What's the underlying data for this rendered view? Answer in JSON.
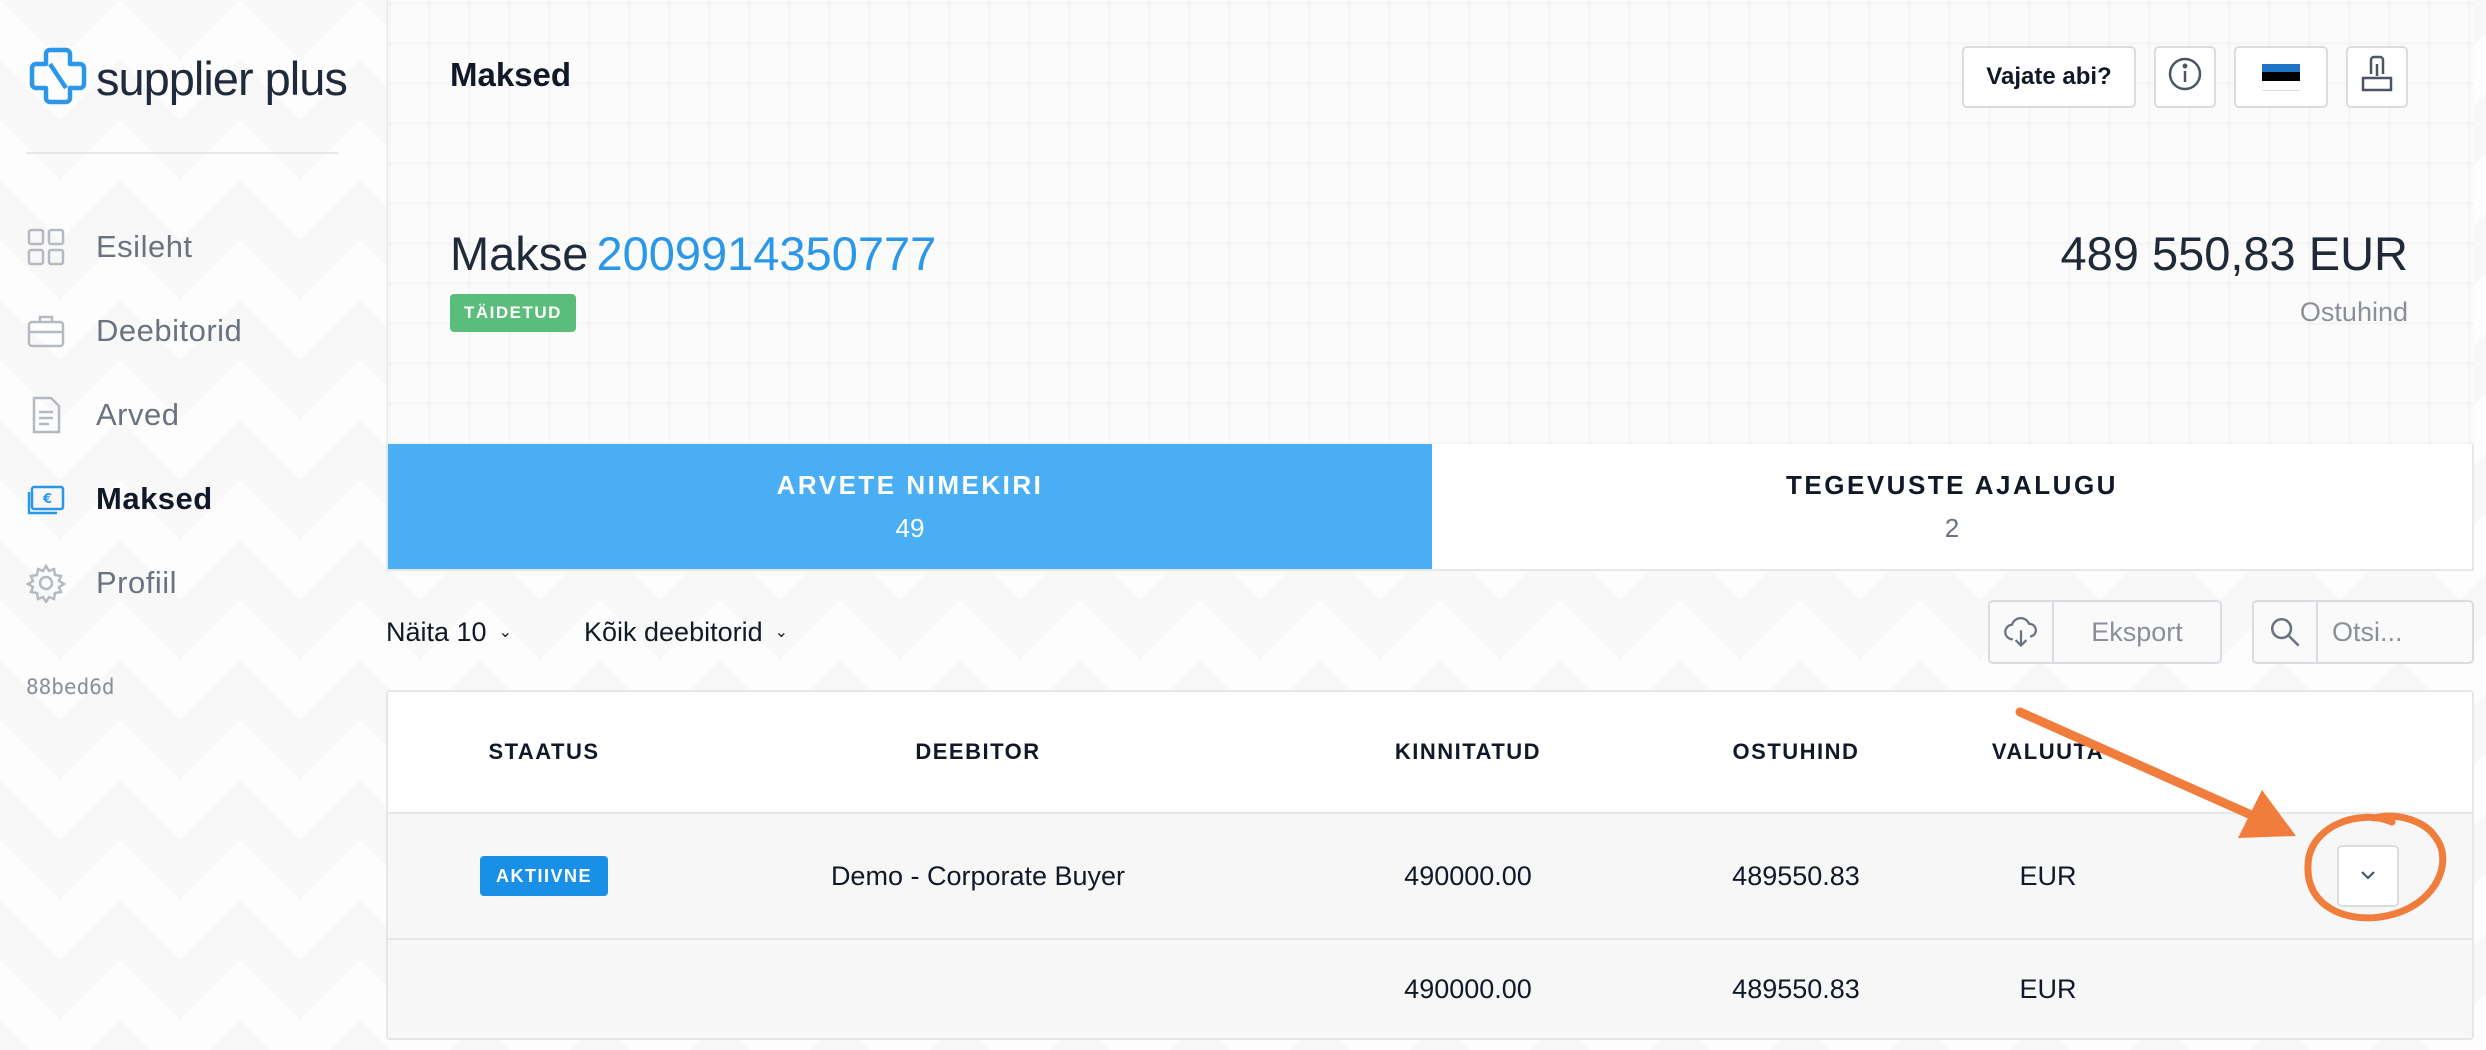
{
  "brand": {
    "name": "supplier plus",
    "color": "#2b97e8"
  },
  "sidebar": {
    "items": [
      {
        "label": "Esileht",
        "icon": "dashboard-grid-icon",
        "active": false
      },
      {
        "label": "Deebitorid",
        "icon": "briefcase-icon",
        "active": false
      },
      {
        "label": "Arved",
        "icon": "document-icon",
        "active": false
      },
      {
        "label": "Maksed",
        "icon": "euro-bill-icon",
        "active": true
      },
      {
        "label": "Profiil",
        "icon": "gear-icon",
        "active": false
      }
    ],
    "build_hash": "88bed6d"
  },
  "header": {
    "title": "Maksed",
    "help_label": "Vajate abi?",
    "info_icon": "info-icon",
    "language_flag": "estonia-flag-icon",
    "logout_icon": "logout-icon",
    "payment_prefix": "Makse",
    "payment_id": "2009914350777",
    "status_badge": "TÄIDETUD",
    "amount": "489 550,83 EUR",
    "amount_label": "Ostuhind",
    "status_color": "#5bbd7b"
  },
  "tabs": [
    {
      "label": "ARVETE NIMEKIRI",
      "count": "49",
      "active": true
    },
    {
      "label": "TEGEVUSTE AJALUGU",
      "count": "2",
      "active": false
    }
  ],
  "toolbar": {
    "show_label": "Näita 10",
    "debtor_filter": "Kõik deebitorid",
    "export_label": "Eksport",
    "search_placeholder": "Otsi..."
  },
  "table": {
    "columns": [
      "STAATUS",
      "DEEBITOR",
      "KINNITATUD",
      "OSTUHIND",
      "VALUUTA"
    ],
    "rows": [
      {
        "status": "AKTIIVNE",
        "debtor": "Demo - Corporate Buyer",
        "fixed": "490000.00",
        "price": "489550.83",
        "currency": "EUR"
      }
    ],
    "totals": {
      "fixed": "490000.00",
      "price": "489550.83",
      "currency": "EUR"
    }
  },
  "colors": {
    "accent": "#4aaef5",
    "active_badge": "#1a8fe8",
    "annotation": "#f07d3c"
  }
}
